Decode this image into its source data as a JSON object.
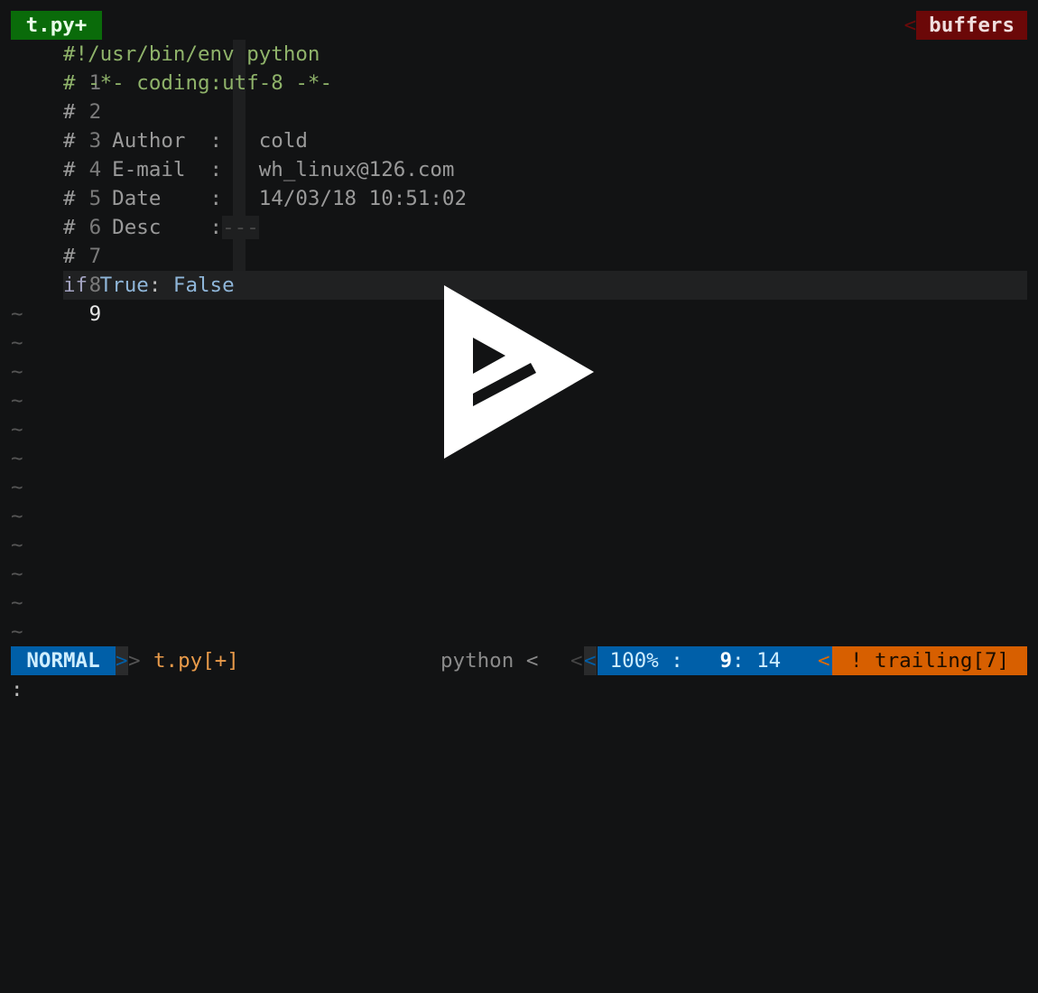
{
  "tabline": {
    "active_tab": "t.py+",
    "separator": "<",
    "buffers_label": "buffers"
  },
  "editor": {
    "lines": [
      {
        "num": "1",
        "text": "#!/usr/bin/env python"
      },
      {
        "num": "2",
        "text": "# -*- coding:utf-8 -*-"
      },
      {
        "num": "3",
        "text": "#"
      },
      {
        "num": "4",
        "text": "#   Author  :   cold"
      },
      {
        "num": "5",
        "text": "#   E-mail  :   wh_linux@126.com"
      },
      {
        "num": "6",
        "text": "#   Date    :   14/03/18 10:51:02"
      },
      {
        "num": "7",
        "text_prefix": "#   Desc    :",
        "text_dashes": "---"
      },
      {
        "num": "8",
        "text": "#"
      },
      {
        "num": "9",
        "kw": "if",
        "bool1": "True",
        "colon": ":",
        "bool2": "False"
      }
    ],
    "tilde": "~"
  },
  "statusline": {
    "mode": "NORMAL",
    "arrow": ">",
    "filename": "t.py[+]",
    "filetype": "python <",
    "pos_sep": "<",
    "percent": "100% :",
    "line": "9",
    "col": ": 14",
    "warn_sep": "<",
    "warning": "! trailing[7]"
  },
  "cmdline": ":",
  "overlay": {
    "icon": "play-icon"
  }
}
